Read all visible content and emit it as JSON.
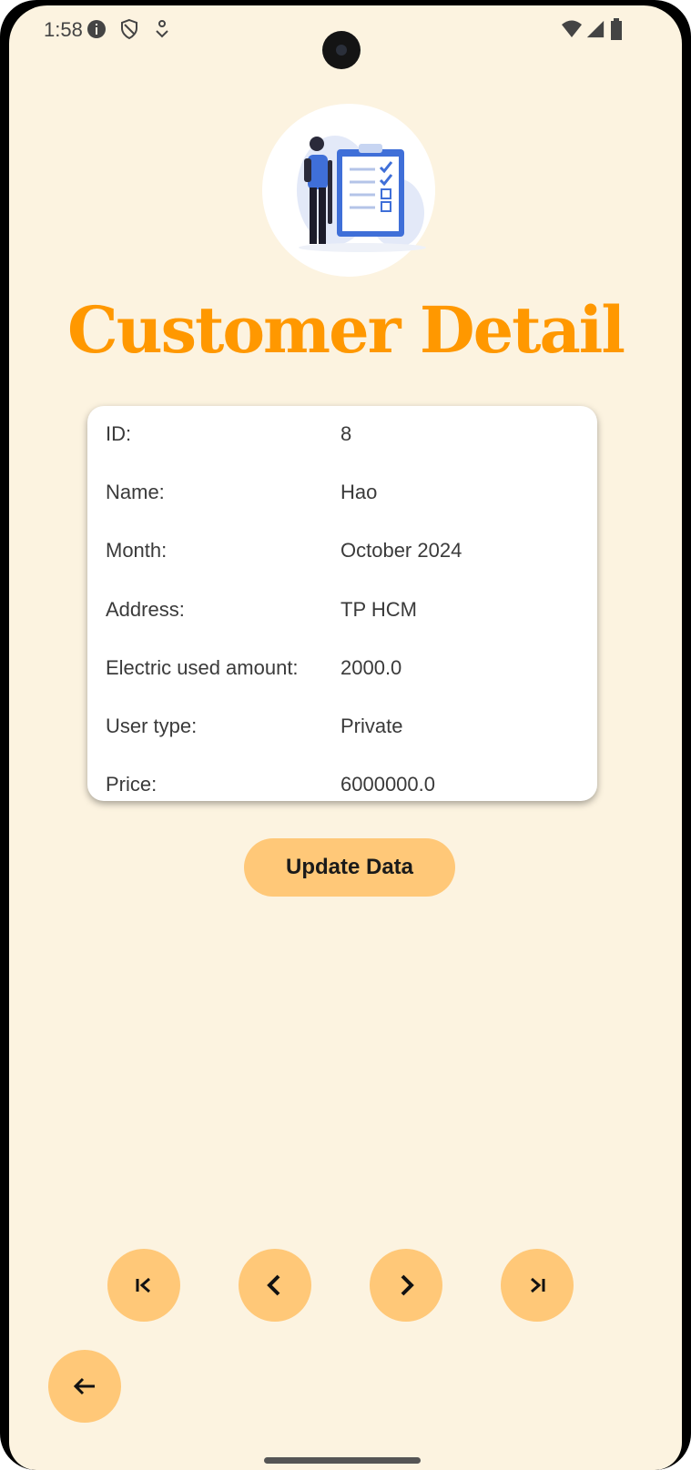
{
  "status_bar": {
    "time": "1:58",
    "icons_left": [
      "info-icon",
      "shield-icon",
      "download-icon"
    ],
    "icons_right": [
      "wifi-icon",
      "signal-icon",
      "battery-icon"
    ]
  },
  "header": {
    "illustration": "checklist-illustration",
    "title": "Customer Detail"
  },
  "details": {
    "rows": [
      {
        "label": "ID:",
        "value": "8"
      },
      {
        "label": "Name:",
        "value": "Hao"
      },
      {
        "label": "Month:",
        "value": "October 2024"
      },
      {
        "label": "Address:",
        "value": "TP HCM"
      },
      {
        "label": "Electric used amount:",
        "value": "2000.0"
      },
      {
        "label": "User type:",
        "value": "Private"
      },
      {
        "label": "Price:",
        "value": "6000000.0"
      }
    ]
  },
  "actions": {
    "update_label": "Update Data"
  },
  "navigation": {
    "first_icon": "first-page-icon",
    "prev_icon": "chevron-left-icon",
    "next_icon": "chevron-right-icon",
    "last_icon": "last-page-icon",
    "back_icon": "arrow-back-icon"
  },
  "colors": {
    "background": "#fcf3e0",
    "title": "#ff9800",
    "button": "#ffc878"
  }
}
